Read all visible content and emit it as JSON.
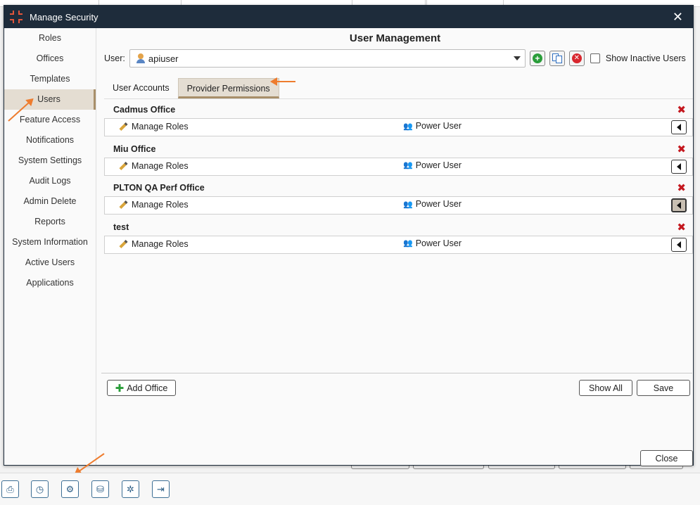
{
  "window": {
    "title": "Manage Security",
    "close_glyph": "✕"
  },
  "sidebar": {
    "items": [
      {
        "label": "Roles"
      },
      {
        "label": "Offices"
      },
      {
        "label": "Templates"
      },
      {
        "label": "Users",
        "active": true
      },
      {
        "label": "Feature Access"
      },
      {
        "label": "Notifications"
      },
      {
        "label": "System Settings"
      },
      {
        "label": "Audit Logs"
      },
      {
        "label": "Admin Delete"
      },
      {
        "label": "Reports"
      },
      {
        "label": "System Information"
      },
      {
        "label": "Active Users"
      },
      {
        "label": "Applications"
      }
    ]
  },
  "main": {
    "heading": "User Management",
    "user_label": "User:",
    "user_value": "apiuser",
    "show_inactive_label": "Show Inactive Users",
    "tabs": [
      {
        "label": "User Accounts",
        "active": false
      },
      {
        "label": "Provider Permissions",
        "active": true
      }
    ],
    "offices": [
      {
        "name": "Cadmus Office",
        "action": "Manage Roles",
        "role": "Power User"
      },
      {
        "name": "Miu Office",
        "action": "Manage Roles",
        "role": "Power User"
      },
      {
        "name": "PLTON QA Perf Office",
        "action": "Manage Roles",
        "role": "Power User",
        "highlighted": true
      },
      {
        "name": "test",
        "action": "Manage Roles",
        "role": "Power User"
      }
    ],
    "add_office_label": "Add Office",
    "show_all_label": "Show All",
    "save_label": "Save",
    "close_label": "Close"
  },
  "taskbar": {
    "icons": [
      "printer-icon",
      "clock-icon",
      "document-settings-icon",
      "database-add-icon",
      "settings-gear-icon",
      "logout-icon"
    ]
  },
  "colors": {
    "titlebar": "#1e2c3b",
    "active_bg": "#e4ddd2",
    "active_border": "#a88f6a",
    "annotation_arrow": "#ee7c2e",
    "delete_red": "#c4181f",
    "add_green": "#2a9d3a"
  }
}
